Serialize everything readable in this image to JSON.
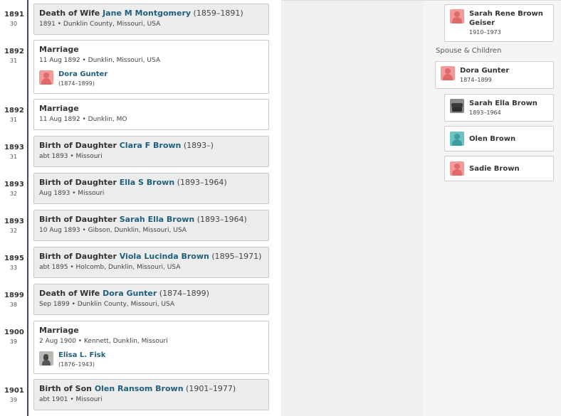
{
  "timeline": [
    {
      "year": "1891",
      "age": "30",
      "prefix": "Death of Wife ",
      "link": "Jane M Montgomery",
      "dates": " (1859–1891)",
      "sub": "1891 • Dunklin County, Missouri, USA"
    },
    {
      "year": "1892",
      "age": "31",
      "prefix": "Marriage",
      "sub": "11 Aug 1892 • Dunklin, Missouri, USA",
      "person_name": "Dora Gunter",
      "person_dates": "(1874–1899)"
    },
    {
      "year": "1892",
      "age": "31",
      "prefix": "Marriage",
      "sub": "11 Aug 1892 • Dunklin, MO"
    },
    {
      "year": "1893",
      "age": "31",
      "prefix": "Birth of Daughter ",
      "link": "Clara F Brown",
      "dates": " (1893–)",
      "sub": "abt 1893 • Missouri"
    },
    {
      "year": "1893",
      "age": "32",
      "prefix": "Birth of Daughter ",
      "link": "Ella S Brown",
      "dates": " (1893–1964)",
      "sub": "Aug 1893 • Missouri"
    },
    {
      "year": "1893",
      "age": "32",
      "prefix": "Birth of Daughter ",
      "link": "Sarah Ella Brown",
      "dates": " (1893–1964)",
      "sub": "10 Aug 1893 • Gibson, Dunklin, Missouri, USA"
    },
    {
      "year": "1895",
      "age": "33",
      "prefix": "Birth of Daughter ",
      "link": "Viola Lucinda Brown",
      "dates": " (1895–1971)",
      "sub": "abt 1895 • Holcomb, Dunklin, Missouri, USA"
    },
    {
      "year": "1899",
      "age": "38",
      "prefix": "Death of Wife ",
      "link": "Dora Gunter",
      "dates": " (1874–1899)",
      "sub": "Sep 1899 • Dunklin County, Missouri, USA"
    },
    {
      "year": "1900",
      "age": "39",
      "prefix": "Marriage",
      "sub": "2 Aug 1900 • Kennett, Dunklin, Missouri",
      "person_name": "Elisa L. Fisk",
      "person_dates": "(1876–1943)"
    },
    {
      "year": "1901",
      "age": "39",
      "prefix": "Birth of Son ",
      "link": "Olen Ransom Brown",
      "dates": " (1901–1977)",
      "sub": "abt 1901 • Missouri"
    }
  ],
  "family": {
    "top_child": {
      "name_line1": "Sarah Rene Brown",
      "name_line2": "Geiser",
      "dates": "1910–1973"
    },
    "section_label": "Spouse & Children",
    "spouse": {
      "name": "Dora Gunter",
      "dates": "1874–1899"
    },
    "children": [
      {
        "name": "Sarah Ella Brown",
        "dates": "1893–1964"
      },
      {
        "name": "Olen Brown",
        "dates": ""
      },
      {
        "name": "Sadie Brown",
        "dates": ""
      }
    ]
  },
  "icons": {
    "female_avatar": "female-silhouette-icon",
    "male_avatar": "male-silhouette-icon",
    "photo_avatar": "photo-thumbnail"
  },
  "colors": {
    "link": "#1e5f7e",
    "timeline_line": "#3b4a6b",
    "female": "#f29a9a",
    "male": "#6cc3c3"
  }
}
